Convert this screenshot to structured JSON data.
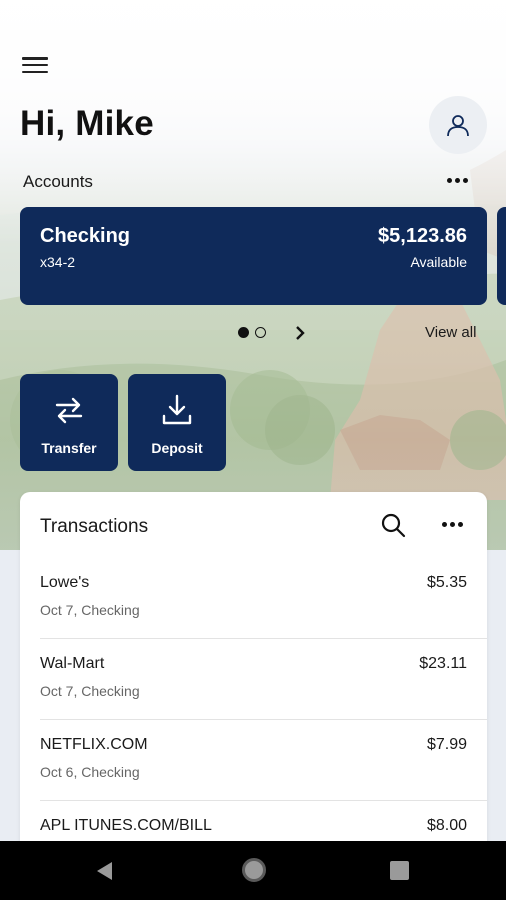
{
  "header": {
    "greeting": "Hi, Mike",
    "menu_icon": "hamburger-menu-icon",
    "profile_icon": "user-icon"
  },
  "accounts": {
    "label": "Accounts",
    "more_icon": "more-dots-icon",
    "cards": [
      {
        "name": "Checking",
        "number": "x34-2",
        "balance": "$5,123.86",
        "balance_label": "Available"
      }
    ],
    "pager": {
      "total": 2,
      "current": 1
    },
    "view_all": "View all"
  },
  "actions": [
    {
      "label": "Transfer",
      "icon": "transfer-arrows-icon"
    },
    {
      "label": "Deposit",
      "icon": "download-icon"
    }
  ],
  "transactions": {
    "title": "Transactions",
    "items": [
      {
        "merchant": "Lowe's",
        "meta": "Oct 7, Checking",
        "amount": "$5.35"
      },
      {
        "merchant": "Wal-Mart",
        "meta": "Oct 7, Checking",
        "amount": "$23.11"
      },
      {
        "merchant": "NETFLIX.COM",
        "meta": "Oct 6, Checking",
        "amount": "$7.99"
      },
      {
        "merchant": "APL ITUNES.COM/BILL",
        "meta": "",
        "amount": "$8.00"
      }
    ]
  },
  "colors": {
    "primary": "#0f2a5a",
    "background": "#e9edf3",
    "card": "#ffffff"
  }
}
